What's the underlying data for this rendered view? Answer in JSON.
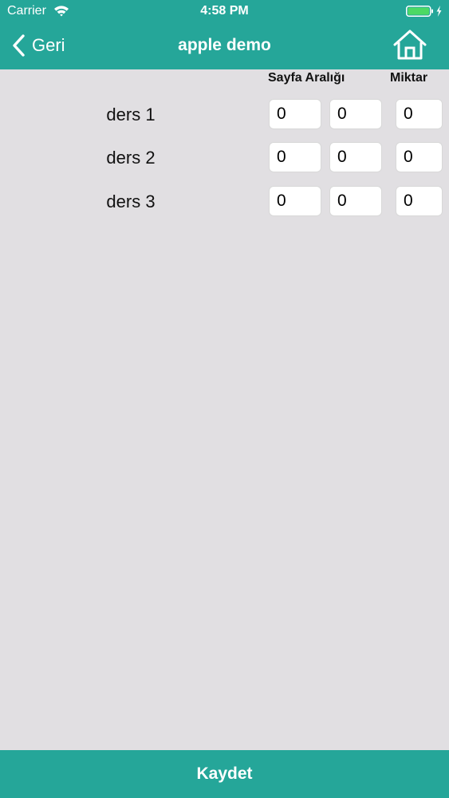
{
  "status_bar": {
    "carrier": "Carrier",
    "time": "4:58 PM"
  },
  "nav": {
    "back_label": "Geri",
    "title": "apple demo"
  },
  "columns": {
    "page_range": "Sayfa Aralığı",
    "quantity": "Miktar"
  },
  "rows": [
    {
      "label": "ders 1",
      "range_start": "0",
      "range_end": "0",
      "quantity": "0"
    },
    {
      "label": "ders 2",
      "range_start": "0",
      "range_end": "0",
      "quantity": "0"
    },
    {
      "label": "ders 3",
      "range_start": "0",
      "range_end": "0",
      "quantity": "0"
    }
  ],
  "footer": {
    "save_label": "Kaydet"
  },
  "colors": {
    "accent": "#25a699",
    "background": "#e1dfe2",
    "battery": "#4cd964"
  }
}
